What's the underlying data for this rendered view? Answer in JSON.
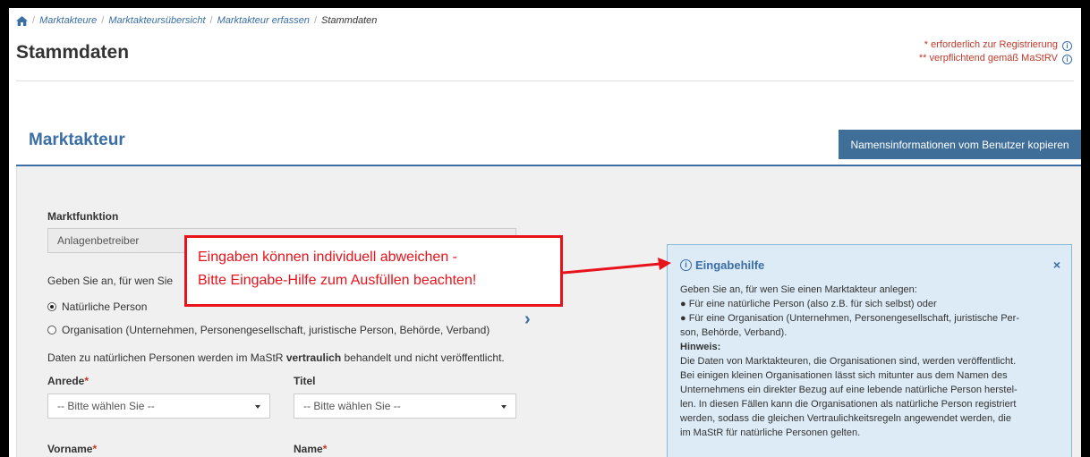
{
  "breadcrumb": {
    "items": [
      "Marktakteure",
      "Marktakteursübersicht",
      "Marktakteur erfassen"
    ],
    "current": "Stammdaten"
  },
  "page": {
    "title": "Stammdaten",
    "required_note": "* erforderlich zur Registrierung",
    "mandatory_note": "** verpflichtend gemäß MaStRV"
  },
  "section": {
    "title": "Marktakteur",
    "copy_button": "Namensinformationen vom Benutzer kopieren"
  },
  "form": {
    "marktfunktion_label": "Marktfunktion",
    "marktfunktion_value": "Anlagenbetreiber",
    "type_question": "Geben Sie an, für wen Sie",
    "option_person": "Natürliche Person",
    "option_org": "Organisation (Unternehmen, Personengesellschaft, juristische Person, Behörde, Verband)",
    "selected_option": "Natürliche Person",
    "privacy_before": "Daten zu natürlichen Personen werden im MaStR ",
    "privacy_bold": "vertraulich",
    "privacy_after": " behandelt und nicht veröffentlicht.",
    "anrede_label": "Anrede",
    "anrede_value": "-- Bitte wählen Sie --",
    "titel_label": "Titel",
    "titel_value": "-- Bitte wählen Sie --",
    "vorname_label": "Vorname",
    "name_label": "Name",
    "required_star": "*"
  },
  "callout": {
    "line1": "Eingaben können individuell abweichen -",
    "line2": "Bitte Eingabe-Hilfe zum Ausfüllen beachten!"
  },
  "help": {
    "title": "Eingabehilfe",
    "close": "×",
    "intro": "Geben Sie an, für wen Sie einen Marktakteur anlegen:",
    "bullet1": "● Für eine natürliche Person (also z.B. für sich selbst) oder",
    "bullet2a": "● Für eine Organisation (Unternehmen, Personengesellschaft, juristische Per-",
    "bullet2b": "son, Behörde, Verband).",
    "hint_label": "Hinweis:",
    "hint1": "Die Daten von Marktakteuren, die Organisationen sind, werden veröffentlicht.",
    "hint2": "Bei einigen kleinen Organisationen lässt sich mitunter aus dem Namen des",
    "hint3": "Unternehmens ein direkter Bezug auf eine lebende natürliche Person herstel-",
    "hint4": "len. In diesen Fällen kann die Organisationen als natürliche Person registriert",
    "hint5": "werden, sodass die gleichen Vertraulichkeitsregeln angewendet werden, die",
    "hint6": "im MaStR für natürliche Personen gelten."
  },
  "colors": {
    "accent": "#3a6ea5",
    "button": "#3f6e98",
    "required": "#c0392b",
    "callout": "#e8121a",
    "help_bg": "#dcebf5"
  }
}
